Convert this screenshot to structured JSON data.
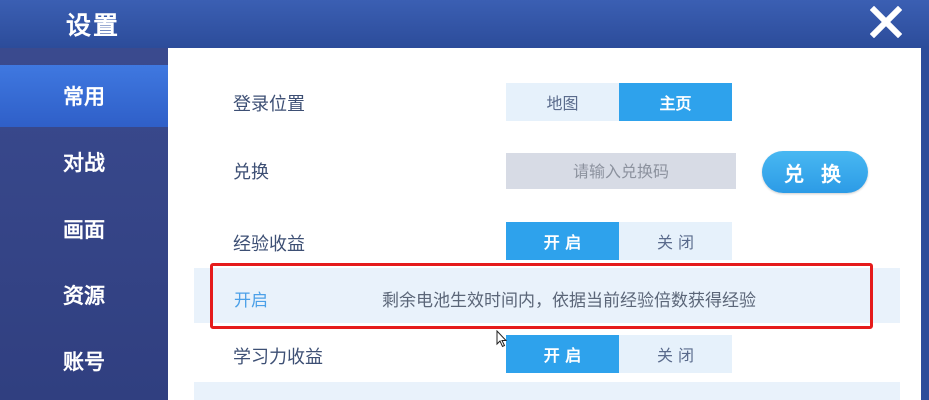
{
  "window": {
    "title": "设置"
  },
  "sidebar": {
    "items": [
      {
        "label": "常用",
        "active": true
      },
      {
        "label": "对战",
        "active": false
      },
      {
        "label": "画面",
        "active": false
      },
      {
        "label": "资源",
        "active": false
      },
      {
        "label": "账号",
        "active": false
      }
    ]
  },
  "settings": {
    "login_location": {
      "label": "登录位置",
      "options": [
        "地图",
        "主页"
      ],
      "selected": "主页"
    },
    "redeem": {
      "label": "兑换",
      "placeholder": "请输入兑换码",
      "button_label": "兑 换"
    },
    "exp_bonus": {
      "label": "经验收益",
      "options": [
        "开 启",
        "关 闭"
      ],
      "selected": "开 启"
    },
    "exp_info": {
      "status": "开启",
      "description": "剩余电池生效时间内，依据当前经验倍数获得经验"
    },
    "study_bonus": {
      "label": "学习力收益",
      "options": [
        "开 启",
        "关 闭"
      ],
      "selected": "开 启"
    }
  },
  "colors": {
    "accent": "#2ea2ec",
    "header": "#2c4c9a",
    "sidebar": "#34458a",
    "highlight_box": "#e51b1b"
  }
}
